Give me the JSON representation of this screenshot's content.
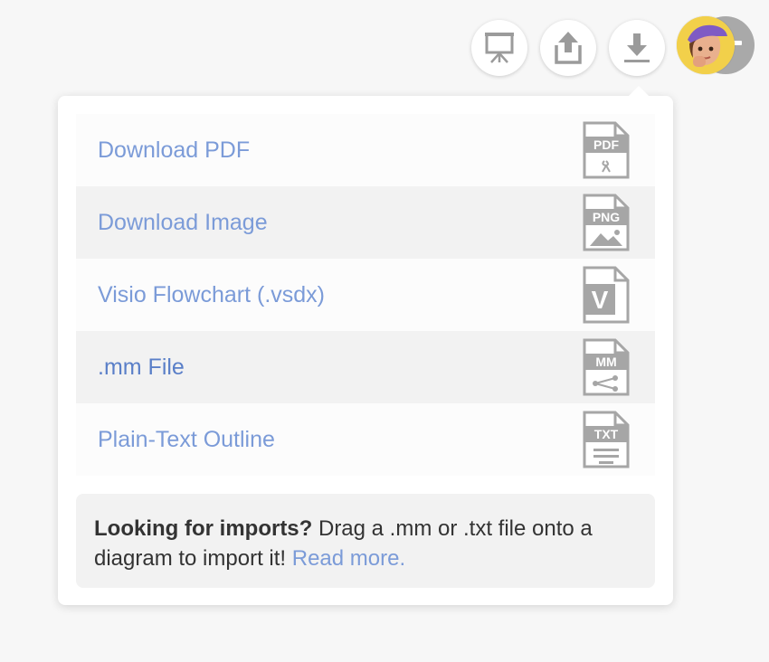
{
  "toolbar": {
    "buttons": [
      {
        "name": "presentation-button",
        "icon": "presentation-screen-icon"
      },
      {
        "name": "share-button",
        "icon": "upload-icon"
      },
      {
        "name": "download-button",
        "icon": "download-icon"
      }
    ],
    "avatar": {
      "icon": "memoji-avatar-icon",
      "background": "#f2d04a"
    }
  },
  "download_menu": {
    "items": [
      {
        "label": "Download PDF",
        "icon": "pdf-file-icon",
        "badge": "PDF"
      },
      {
        "label": "Download Image",
        "icon": "png-file-icon",
        "badge": "PNG"
      },
      {
        "label": "Visio Flowchart (.vsdx)",
        "icon": "visio-file-icon",
        "badge": "V"
      },
      {
        "label": ".mm File",
        "icon": "mm-file-icon",
        "badge": "MM"
      },
      {
        "label": "Plain-Text Outline",
        "icon": "txt-file-icon",
        "badge": "TXT"
      }
    ]
  },
  "imports_note": {
    "heading": "Looking for imports?",
    "body": " Drag a .mm or .txt file onto a diagram to import it! ",
    "link": "Read more."
  },
  "colors": {
    "link": "#7b9bd8",
    "icon_gray": "#a6a6a6",
    "row_alt": "#f2f2f2"
  }
}
